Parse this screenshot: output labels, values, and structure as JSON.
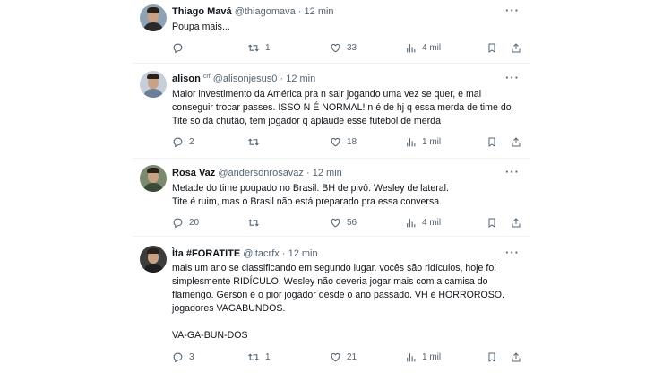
{
  "tweets": [
    {
      "name": "Thiago Mavá",
      "handle": "@thiagomava",
      "dot": "·",
      "time": "12 min",
      "badge": "",
      "lines": [
        "Poupa mais..."
      ],
      "replies": "",
      "retweets": "1",
      "likes": "33",
      "views": "4 mil",
      "avatar_bg": "#8fa2b4",
      "shirt": "#2a2a2a"
    },
    {
      "name": "alison",
      "handle": "@alisonjesus0",
      "dot": "·",
      "time": "12 min",
      "badge": "crf",
      "lines": [
        "Maior investimento da América  pra n sair jogando uma vez se quer, e mal",
        "conseguir trocar passes. ISSO N É NORMAL! n é de hj q essa merda de time do",
        "Tite só dá chutão, tem jogador q aplaude esse futebol de merda"
      ],
      "replies": "2",
      "retweets": "",
      "likes": "18",
      "views": "1 mil",
      "avatar_bg": "#c6ced8",
      "shirt": "#6b7e95"
    },
    {
      "name": "Rosa Vaz",
      "handle": "@andersonrosavaz",
      "dot": "·",
      "time": "12 min",
      "badge": "",
      "lines": [
        "Metade do time poupado no Brasil. BH de pivô. Wesley de lateral.",
        "Tite é ruim, mas o Brasil não está preparado pra essa conversa."
      ],
      "replies": "20",
      "retweets": "",
      "likes": "56",
      "views": "4 mil",
      "avatar_bg": "#7a8a6e",
      "shirt": "#3c4a3a"
    },
    {
      "name": "Ìta #FORATITE",
      "handle": "@itacrfx",
      "dot": "·",
      "time": "12 min",
      "badge": "",
      "lines": [
        "mais um ano se classificando em segundo lugar. vocês são ridículos, hoje foi",
        "simplesmente RIDÍCULO. Wesley não deveria jogar mais com a camisa do",
        "flamengo. Gerson é o pior jogador desde o ano passado. VH é HORROROSO.",
        "jogadores VAGABUNDOS.",
        "",
        "VA-GA-BUN-DOS"
      ],
      "replies": "3",
      "retweets": "1",
      "likes": "21",
      "views": "1 mil",
      "avatar_bg": "#3d3d3d",
      "shirt": "#1f1f1f"
    }
  ],
  "icons": {
    "more": "more-icon",
    "reply": "reply-icon",
    "retweet": "retweet-icon",
    "like": "like-icon",
    "views": "views-icon",
    "bookmark": "bookmark-icon",
    "share": "share-icon"
  },
  "colors": {
    "text": "#0f1419",
    "secondary": "#536471",
    "border": "#eff3f4"
  }
}
